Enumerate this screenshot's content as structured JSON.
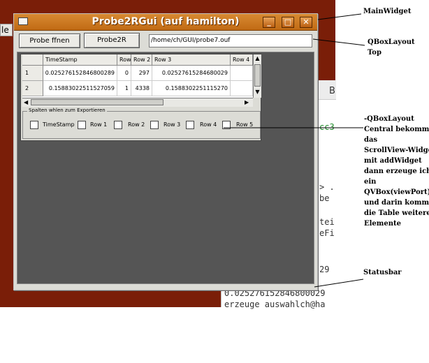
{
  "window": {
    "title": "Probe2RGui (auf hamilton)"
  },
  "toolbar": {
    "probe_button": "Probe ffnen",
    "probe2r_button": "Probe2R",
    "path_value": "/home/ch/GUI/probe7.ouf"
  },
  "table": {
    "headers": [
      "TimeStamp",
      "Row",
      "Row 2",
      "Row 3",
      "Row 4"
    ],
    "rows": [
      {
        "num": "1",
        "cells": [
          "0.025276152846800289",
          "0",
          "297",
          "0.02527615284680029",
          ""
        ]
      },
      {
        "num": "2",
        "cells": [
          "0.15883022511527059",
          "1",
          "4338",
          "0.1588302251115270",
          ""
        ]
      }
    ]
  },
  "export": {
    "title": "Spalten whlen zum Exportieren",
    "options": [
      "TimeStamp",
      "Row 1",
      "Row 2",
      "Row 3",
      "Row 4",
      "Row 5"
    ]
  },
  "desktop": {
    "tab_label": "le"
  },
  "terminal": {
    "tab": "B",
    "lines": [
      "cc3",
      "> .",
      "be",
      "tei",
      "eFi",
      "29",
      "0.025276152846800029",
      "erzeuge auswahlch@ha"
    ],
    "line_colors": {
      "cc3": "#1f8a2a",
      "default": "#333333"
    }
  },
  "annotations": {
    "main_widget": "MainWidget",
    "top": [
      "QBoxLayout",
      "Top"
    ],
    "central": [
      "-QBoxLayout",
      "Central bekommt",
      "das",
      "ScrollView-Widget",
      "mit addWidget",
      "dann erzeuge ich",
      "ein",
      "QVBox(viewPort)",
      "und darin kommen",
      "die Table weitere",
      "Elemente"
    ],
    "statusbar": "Statusbar"
  }
}
